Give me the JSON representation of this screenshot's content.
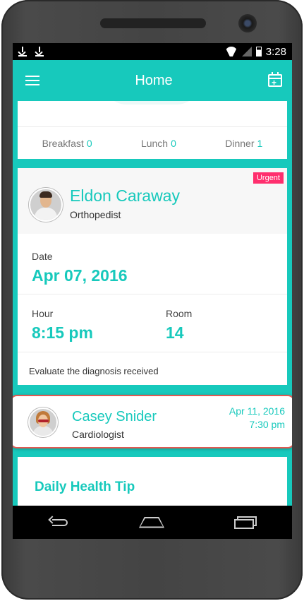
{
  "status_bar": {
    "time": "3:28"
  },
  "app_bar": {
    "title": "Home"
  },
  "meals": [
    {
      "label": "Breakfast",
      "count": "0"
    },
    {
      "label": "Lunch",
      "count": "0"
    },
    {
      "label": "Dinner",
      "count": "1"
    }
  ],
  "appointment": {
    "badge": "Urgent",
    "doctor": "Eldon Caraway",
    "specialty": "Orthopedist",
    "date_label": "Date",
    "date_value": "Apr 07, 2016",
    "hour_label": "Hour",
    "hour_value": "8:15 pm",
    "room_label": "Room",
    "room_value": "14",
    "note": "Evaluate the diagnosis received"
  },
  "next_appointment": {
    "doctor": "Casey Snider",
    "specialty": "Cardiologist",
    "date": "Apr 11, 2016",
    "time": "7:30 pm"
  },
  "tip": {
    "title": "Daily Health Tip"
  },
  "colors": {
    "accent": "#17c9bc",
    "urgent": "#ff2f6e",
    "highlight_border": "#e05a52"
  }
}
